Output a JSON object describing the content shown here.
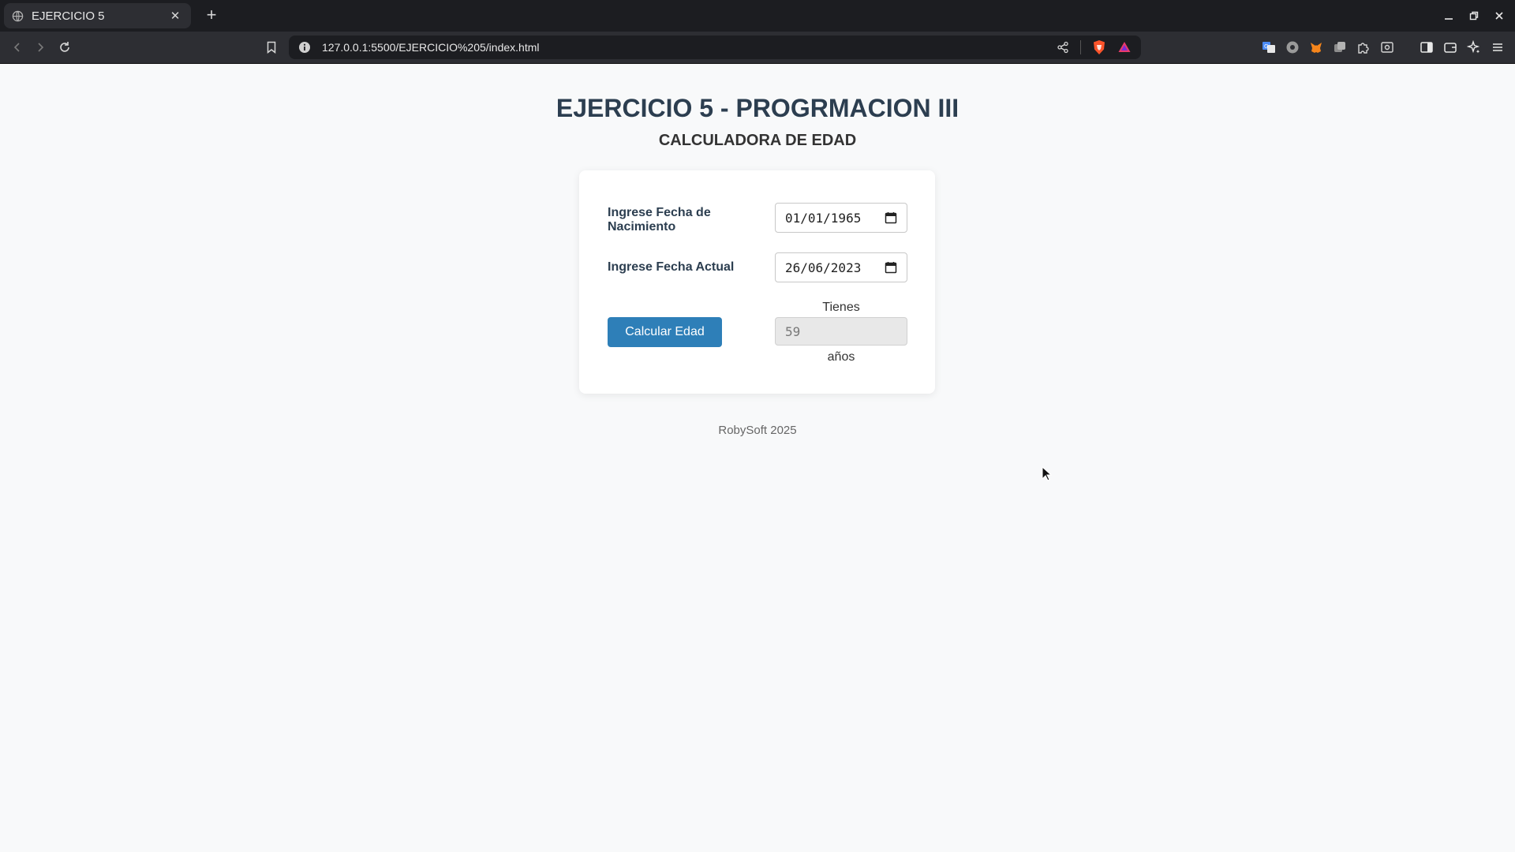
{
  "browser": {
    "tab_title": "EJERCICIO 5",
    "url": "127.0.0.1:5500/EJERCICIO%205/index.html",
    "icons": {
      "tab": "globe-icon",
      "close": "close-icon",
      "new_tab": "plus-icon",
      "back": "back-icon",
      "forward": "forward-icon",
      "reload": "reload-icon",
      "bookmark": "bookmark-icon",
      "site_info": "info-icon",
      "share": "share-icon",
      "shields": "brave-shield-icon",
      "rewards": "brave-rewards-icon",
      "sidebar": "sidebar-icon",
      "wallet": "wallet-icon",
      "leo": "ai-assistant-icon",
      "menu": "menu-icon"
    },
    "colors": {
      "tabbar": "#1c1d21",
      "toolbar": "#2d2e33",
      "shield": "#fb542b"
    }
  },
  "page": {
    "title": "EJERCICIO 5 - PROGRMACION III",
    "subtitle": "CALCULADORA DE EDAD",
    "form": {
      "birth_label": "Ingrese Fecha de Nacimiento",
      "birth_value": "01/01/1965",
      "current_label": "Ingrese Fecha Actual",
      "current_value": "26/06/2023",
      "button_label": "Calcular Edad",
      "result_prefix": "Tienes",
      "result_value": "59",
      "result_suffix": "años"
    },
    "footer": "RobySoft 2025",
    "colors": {
      "title": "#2c3e50",
      "button": "#2e7fb8",
      "background": "#f8f9fa"
    }
  }
}
